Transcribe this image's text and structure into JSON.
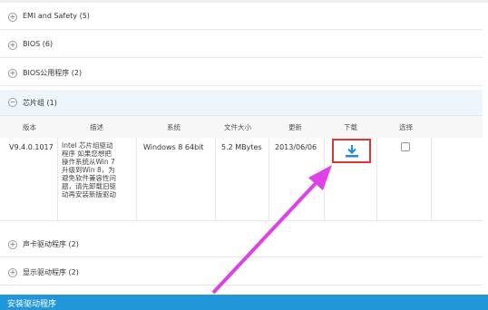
{
  "categories_top": [
    {
      "label": "EMI and Safety  (5)",
      "toggle": "+"
    },
    {
      "label": "BIOS (6)",
      "toggle": "+"
    },
    {
      "label": "BIOS公用程序 (2)",
      "toggle": "+"
    },
    {
      "label": "芯片组 (1)",
      "toggle": "−"
    }
  ],
  "table": {
    "headers": [
      "版本",
      "描述",
      "系统",
      "文件大小",
      "更新",
      "下载",
      "选择"
    ],
    "row": {
      "version": "V9.4.0.1017",
      "description": "Intel 芯片组驱动程序 如果您想把操作系统从Win 7升级到Win 8，为避免软件兼容性问题，请先卸载旧驱动再安装新版驱动",
      "os": "Windows 8 64bit",
      "size": "5.2 MBytes",
      "date": "2013/06/06"
    }
  },
  "categories_bottom": [
    {
      "label": "声卡驱动程序  (2)",
      "toggle": "+"
    },
    {
      "label": "显示驱动程序  (2)",
      "toggle": "+"
    }
  ],
  "bottom_bar": {
    "label": "安装驱动程序"
  },
  "icons": {
    "download": "download-icon",
    "annotation": "magenta-arrow"
  },
  "colors": {
    "accent": "#2196d9",
    "highlight_box": "#e53333",
    "arrow": "#e040e8",
    "download_icon": "#1e90d6"
  }
}
